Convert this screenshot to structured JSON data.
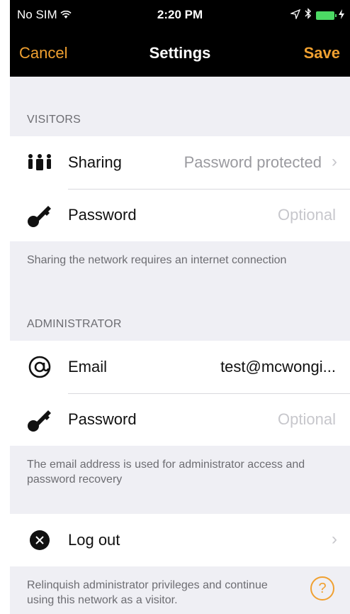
{
  "status_bar": {
    "carrier": "No SIM",
    "time": "2:20 PM"
  },
  "nav": {
    "cancel_label": "Cancel",
    "title": "Settings",
    "save_label": "Save"
  },
  "visitors": {
    "header": "VISITORS",
    "sharing_label": "Sharing",
    "sharing_value": "Password protected",
    "password_label": "Password",
    "password_placeholder": "Optional",
    "note": "Sharing the network requires an internet connection"
  },
  "administrator": {
    "header": "ADMINISTRATOR",
    "email_label": "Email",
    "email_value": "test@mcwongi...",
    "password_label": "Password",
    "password_placeholder": "Optional",
    "note": "The email address is used for administrator access and password recovery"
  },
  "logout": {
    "label": "Log out",
    "note": "Relinquish administrator privileges and continue using this network as a visitor.",
    "help_glyph": "?"
  },
  "colors": {
    "accent": "#f0a030",
    "background": "#efeff4",
    "battery": "#4cd964"
  }
}
